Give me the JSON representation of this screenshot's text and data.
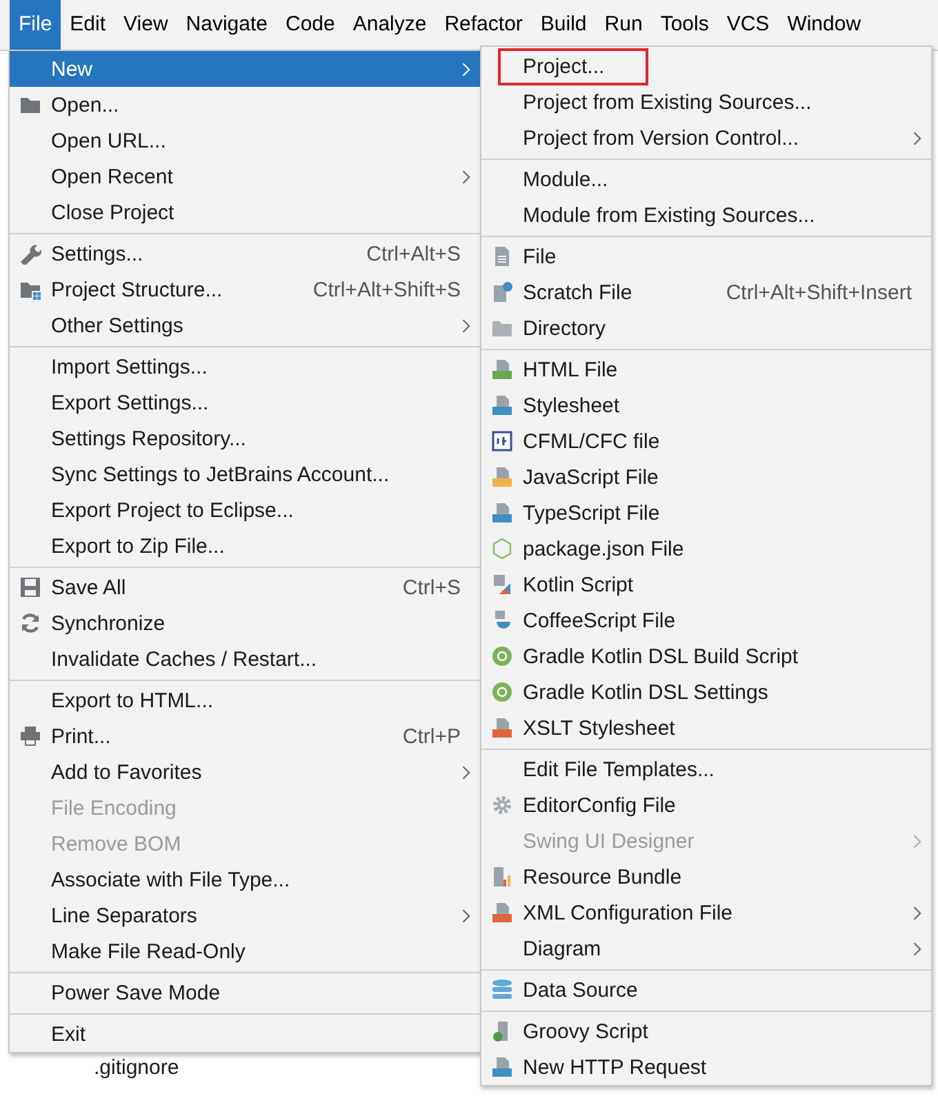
{
  "menubar": [
    {
      "label": "File",
      "selected": true
    },
    {
      "label": "Edit",
      "selected": false
    },
    {
      "label": "View",
      "selected": false
    },
    {
      "label": "Navigate",
      "selected": false
    },
    {
      "label": "Code",
      "selected": false
    },
    {
      "label": "Analyze",
      "selected": false
    },
    {
      "label": "Refactor",
      "selected": false
    },
    {
      "label": "Build",
      "selected": false
    },
    {
      "label": "Run",
      "selected": false
    },
    {
      "label": "Tools",
      "selected": false
    },
    {
      "label": "VCS",
      "selected": false
    },
    {
      "label": "Window",
      "selected": false
    }
  ],
  "project_tree": {
    "file": ".gitignore"
  },
  "file_menu": [
    {
      "items": [
        {
          "label": "New",
          "submenu": true,
          "selected": true,
          "disabled": false
        },
        {
          "label": "Open...",
          "submenu": false,
          "selected": false,
          "disabled": false
        },
        {
          "label": "Open URL...",
          "submenu": false,
          "selected": false,
          "disabled": false
        },
        {
          "label": "Open Recent",
          "submenu": true,
          "selected": false,
          "disabled": false
        },
        {
          "label": "Close Project",
          "submenu": false,
          "selected": false,
          "disabled": false
        }
      ]
    },
    {
      "items": [
        {
          "label": "Settings...",
          "shortcut": "Ctrl+Alt+S",
          "submenu": false,
          "selected": false,
          "disabled": false
        },
        {
          "label": "Project Structure...",
          "shortcut": "Ctrl+Alt+Shift+S",
          "submenu": false,
          "selected": false,
          "disabled": false
        },
        {
          "label": "Other Settings",
          "submenu": true,
          "selected": false,
          "disabled": false
        }
      ]
    },
    {
      "items": [
        {
          "label": "Import Settings...",
          "submenu": false,
          "selected": false,
          "disabled": false
        },
        {
          "label": "Export Settings...",
          "submenu": false,
          "selected": false,
          "disabled": false
        },
        {
          "label": "Settings Repository...",
          "submenu": false,
          "selected": false,
          "disabled": false
        },
        {
          "label": "Sync Settings to JetBrains Account...",
          "submenu": false,
          "selected": false,
          "disabled": false
        },
        {
          "label": "Export Project to Eclipse...",
          "submenu": false,
          "selected": false,
          "disabled": false
        },
        {
          "label": "Export to Zip File...",
          "submenu": false,
          "selected": false,
          "disabled": false
        }
      ]
    },
    {
      "items": [
        {
          "label": "Save All",
          "shortcut": "Ctrl+S",
          "submenu": false,
          "selected": false,
          "disabled": false
        },
        {
          "label": "Synchronize",
          "submenu": false,
          "selected": false,
          "disabled": false
        },
        {
          "label": "Invalidate Caches / Restart...",
          "submenu": false,
          "selected": false,
          "disabled": false
        }
      ]
    },
    {
      "items": [
        {
          "label": "Export to HTML...",
          "submenu": false,
          "selected": false,
          "disabled": false
        },
        {
          "label": "Print...",
          "shortcut": "Ctrl+P",
          "submenu": false,
          "selected": false,
          "disabled": false
        },
        {
          "label": "Add to Favorites",
          "submenu": true,
          "selected": false,
          "disabled": false
        },
        {
          "label": "File Encoding",
          "submenu": false,
          "selected": false,
          "disabled": true
        },
        {
          "label": "Remove BOM",
          "submenu": false,
          "selected": false,
          "disabled": true
        },
        {
          "label": "Associate with File Type...",
          "submenu": false,
          "selected": false,
          "disabled": false
        },
        {
          "label": "Line Separators",
          "submenu": true,
          "selected": false,
          "disabled": false
        },
        {
          "label": "Make File Read-Only",
          "submenu": false,
          "selected": false,
          "disabled": false
        }
      ]
    },
    {
      "items": [
        {
          "label": "Power Save Mode",
          "submenu": false,
          "selected": false,
          "disabled": false
        }
      ]
    },
    {
      "items": [
        {
          "label": "Exit",
          "submenu": false,
          "selected": false,
          "disabled": false
        }
      ]
    }
  ],
  "new_submenu": [
    {
      "items": [
        {
          "label": "Project...",
          "submenu": false,
          "highlighted": true,
          "disabled": false
        },
        {
          "label": "Project from Existing Sources...",
          "submenu": false,
          "highlighted": false,
          "disabled": false
        },
        {
          "label": "Project from Version Control...",
          "submenu": true,
          "highlighted": false,
          "disabled": false
        }
      ]
    },
    {
      "items": [
        {
          "label": "Module...",
          "submenu": false,
          "highlighted": false,
          "disabled": false
        },
        {
          "label": "Module from Existing Sources...",
          "submenu": false,
          "highlighted": false,
          "disabled": false
        }
      ]
    },
    {
      "items": [
        {
          "label": "File",
          "submenu": false,
          "highlighted": false,
          "disabled": false
        },
        {
          "label": "Scratch File",
          "shortcut": "Ctrl+Alt+Shift+Insert",
          "submenu": false,
          "highlighted": false,
          "disabled": false
        },
        {
          "label": "Directory",
          "submenu": false,
          "highlighted": false,
          "disabled": false
        }
      ]
    },
    {
      "items": [
        {
          "label": "HTML File",
          "submenu": false,
          "highlighted": false,
          "disabled": false
        },
        {
          "label": "Stylesheet",
          "submenu": false,
          "highlighted": false,
          "disabled": false
        },
        {
          "label": "CFML/CFC file",
          "submenu": false,
          "highlighted": false,
          "disabled": false
        },
        {
          "label": "JavaScript File",
          "submenu": false,
          "highlighted": false,
          "disabled": false
        },
        {
          "label": "TypeScript File",
          "submenu": false,
          "highlighted": false,
          "disabled": false
        },
        {
          "label": "package.json File",
          "submenu": false,
          "highlighted": false,
          "disabled": false
        },
        {
          "label": "Kotlin Script",
          "submenu": false,
          "highlighted": false,
          "disabled": false
        },
        {
          "label": "CoffeeScript File",
          "submenu": false,
          "highlighted": false,
          "disabled": false
        },
        {
          "label": "Gradle Kotlin DSL Build Script",
          "submenu": false,
          "highlighted": false,
          "disabled": false
        },
        {
          "label": "Gradle Kotlin DSL Settings",
          "submenu": false,
          "highlighted": false,
          "disabled": false
        },
        {
          "label": "XSLT Stylesheet",
          "submenu": false,
          "highlighted": false,
          "disabled": false
        }
      ]
    },
    {
      "items": [
        {
          "label": "Edit File Templates...",
          "submenu": false,
          "highlighted": false,
          "disabled": false
        },
        {
          "label": "EditorConfig File",
          "submenu": false,
          "highlighted": false,
          "disabled": false
        },
        {
          "label": "Swing UI Designer",
          "submenu": true,
          "highlighted": false,
          "disabled": true
        },
        {
          "label": "Resource Bundle",
          "submenu": false,
          "highlighted": false,
          "disabled": false
        },
        {
          "label": "XML Configuration File",
          "submenu": true,
          "highlighted": false,
          "disabled": false
        },
        {
          "label": "Diagram",
          "submenu": true,
          "highlighted": false,
          "disabled": false
        }
      ]
    },
    {
      "items": [
        {
          "label": "Data Source",
          "submenu": false,
          "highlighted": false,
          "disabled": false
        }
      ]
    },
    {
      "items": [
        {
          "label": "Groovy Script",
          "submenu": false,
          "highlighted": false,
          "disabled": false
        },
        {
          "label": "New HTTP Request",
          "submenu": false,
          "highlighted": false,
          "disabled": false
        }
      ]
    }
  ]
}
